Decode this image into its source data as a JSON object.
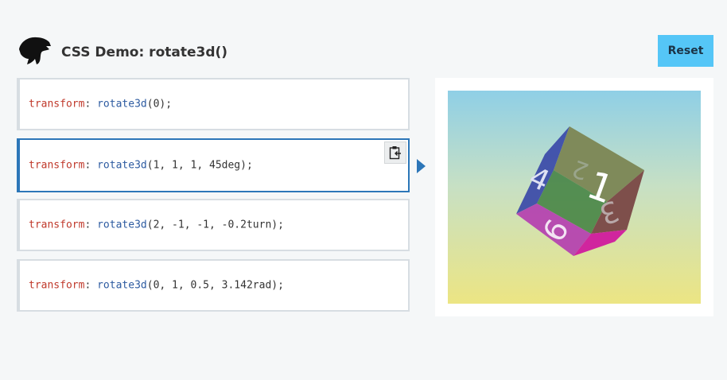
{
  "header": {
    "title": "CSS Demo: rotate3d()",
    "reset_label": "Reset"
  },
  "examples": [
    {
      "prop": "transform",
      "fn": "rotate3d",
      "args": "0"
    },
    {
      "prop": "transform",
      "fn": "rotate3d",
      "args": "1, 1, 1, 45deg"
    },
    {
      "prop": "transform",
      "fn": "rotate3d",
      "args": "2, -1, -1, -0.2turn"
    },
    {
      "prop": "transform",
      "fn": "rotate3d",
      "args": "0, 1, 0.5, 3.142rad"
    }
  ],
  "selected_example": 1,
  "cube_faces": {
    "front": "1",
    "top": "2",
    "right": "3",
    "left": "4",
    "bottom": "6"
  },
  "colors": {
    "accent": "#2c76b8",
    "reset_bg": "#55c6f7",
    "property": "#c0392b",
    "function": "#2c5aa0"
  },
  "icons": {
    "logo": "dino-logo-icon",
    "copy": "clipboard-copy-icon",
    "indicator": "play-arrow-icon"
  }
}
